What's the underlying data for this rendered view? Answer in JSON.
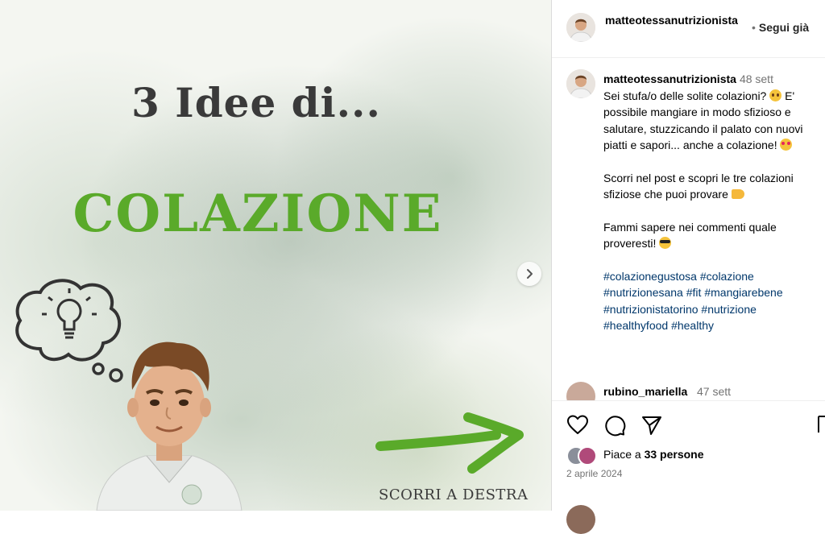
{
  "post_image": {
    "title_line1": "3 Idee di...",
    "title_line2": "COLAZIONE",
    "scroll_hint": "SCORRI A DESTRA",
    "accent_color": "#5aaa2a"
  },
  "header": {
    "username": "matteotessanutrizionista",
    "follow_separator": "•",
    "follow_label": "Segui già"
  },
  "caption": {
    "username": "matteotessanutrizionista",
    "time": "48 sett",
    "p1": "Sei stufa/o delle solite colazioni?",
    "p1b": "E' possibile mangiare in modo sfizioso e salutare, stuzzicando il palato con nuovi piatti e sapori... anche a colazione!",
    "p2": "Scorri nel post e scopri le tre colazioni sfiziose che puoi provare",
    "p3": "Fammi sapere nei commenti quale proveresti!",
    "hashtags": [
      "#colazionegustosa",
      "#colazione",
      "#nutrizionesana",
      "#fit",
      "#mangiarebene",
      "#nutrizionistatorino",
      "#nutrizione",
      "#healthyfood",
      "#healthy"
    ]
  },
  "comment": {
    "username": "rubino_mariella",
    "time": "47 sett"
  },
  "likes": {
    "prefix": "Piace a",
    "count_label": "33 persone"
  },
  "post_date": "2 aprile 2024",
  "icons": {
    "like": "heart-icon",
    "comment": "comment-bubble-icon",
    "share": "paper-plane-icon",
    "save": "bookmark-icon",
    "next": "chevron-right-icon"
  }
}
